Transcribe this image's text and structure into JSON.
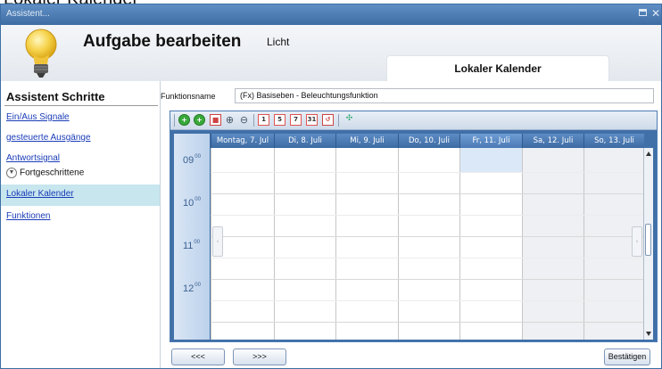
{
  "doc_heading": "Lokaler Kalender",
  "window": {
    "title": "Assistent..."
  },
  "header": {
    "title": "Aufgabe bearbeiten",
    "subtitle": "Licht",
    "active_tab": "Lokaler Kalender"
  },
  "sidebar": {
    "title": "Assistent Schritte",
    "items": [
      {
        "label": "Ein/Aus Signale"
      },
      {
        "label": "gesteuerte Ausgänge"
      },
      {
        "label": "Antwortsignal"
      }
    ],
    "group_label": "Fortgeschrittene",
    "sub_items": [
      {
        "label": "Lokaler Kalender",
        "selected": true
      },
      {
        "label": "Funktionen"
      }
    ]
  },
  "form": {
    "function_name_label": "Funktionsname",
    "function_name_value": "(Fx) Basiseben - Beleuchtungsfunktion"
  },
  "calendar": {
    "toolbar_icons": [
      "add-icon",
      "add-series-icon",
      "delete-icon",
      "zoom-in-icon",
      "zoom-out-icon",
      "day-view-icon",
      "workweek-view-icon",
      "week-view-icon",
      "month-view-icon",
      "clear-icon",
      "settings-icon"
    ],
    "toolbar_icon_glyphs": {
      "day": "1",
      "workweek": "5",
      "week": "7",
      "month": "31"
    },
    "days": [
      {
        "label": "Montag, 7. Jul"
      },
      {
        "label": "Di, 8. Juli"
      },
      {
        "label": "Mi, 9. Juli"
      },
      {
        "label": "Do, 10. Juli"
      },
      {
        "label": "Fr, 11. Juli",
        "today": true
      },
      {
        "label": "Sa, 12. Juli",
        "weekend": true
      },
      {
        "label": "So, 13. Juli",
        "weekend": true
      }
    ],
    "hours": [
      {
        "h": "09",
        "m": "00"
      },
      {
        "h": "10",
        "m": "00"
      },
      {
        "h": "11",
        "m": "00"
      },
      {
        "h": "12",
        "m": "00"
      }
    ],
    "colors": {
      "frame": "#4170a8",
      "today": "#dbe8f8",
      "weekend": "#eef0f3",
      "selected_step": "#c7e6ee"
    }
  },
  "buttons": {
    "back": "<<<",
    "next": ">>>",
    "confirm": "Bestätigen"
  }
}
